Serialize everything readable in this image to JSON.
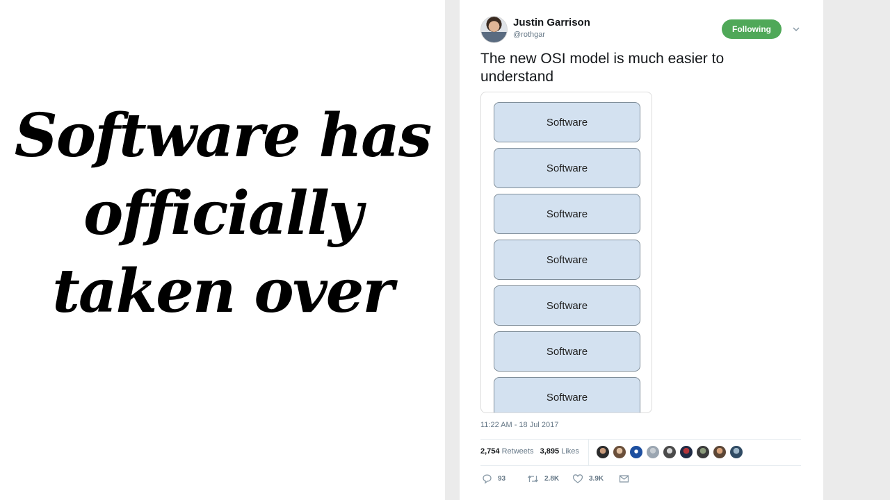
{
  "slide": {
    "title_lines": [
      "Software has",
      "officially",
      "taken over"
    ]
  },
  "tweet": {
    "author_name": "Justin Garrison",
    "author_handle": "@rothgar",
    "follow_label": "Following",
    "text": "The new OSI model is much easier to understand",
    "image_layers": [
      "Software",
      "Software",
      "Software",
      "Software",
      "Software",
      "Software",
      "Software"
    ],
    "timestamp": "11:22 AM - 18 Jul 2017",
    "retweets_count": "2,754",
    "retweets_label": "Retweets",
    "likes_count": "3,895",
    "likes_label": "Likes",
    "reply_count": "93",
    "retweet_action_count": "2.8K",
    "like_action_count": "3.9K"
  },
  "icons": {
    "caret": "chevron-down-icon",
    "reply": "reply-icon",
    "retweet": "retweet-icon",
    "like": "heart-icon",
    "message": "envelope-icon"
  },
  "colors": {
    "follow_button": "#4fa858",
    "layer_fill": "#d3e1f0",
    "layer_border": "#7f8d99",
    "muted_text": "#657786",
    "page_gray": "#ebebeb"
  }
}
